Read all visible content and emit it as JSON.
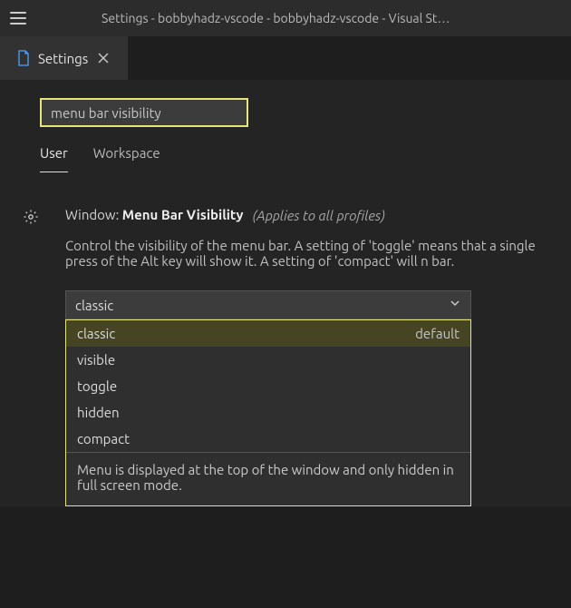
{
  "window": {
    "title": "Settings - bobbyhadz-vscode - bobbyhadz-vscode - Visual St…"
  },
  "tab": {
    "label": "Settings"
  },
  "search": {
    "value": "menu bar visibility"
  },
  "scopes": {
    "user": "User",
    "workspace": "Workspace"
  },
  "setting": {
    "category": "Window: ",
    "name": "Menu Bar Visibility",
    "applies": "(Applies to all profiles)",
    "description": "Control the visibility of the menu bar. A setting of 'toggle' means that a single press of the Alt key will show it. A setting of 'compact' will n bar.",
    "selected": "classic"
  },
  "dropdown": {
    "options": [
      {
        "label": "classic",
        "tag": "default"
      },
      {
        "label": "visible",
        "tag": ""
      },
      {
        "label": "toggle",
        "tag": ""
      },
      {
        "label": "hidden",
        "tag": ""
      },
      {
        "label": "compact",
        "tag": ""
      }
    ],
    "description": "Menu is displayed at the top of the window and only hidden in full screen mode."
  }
}
